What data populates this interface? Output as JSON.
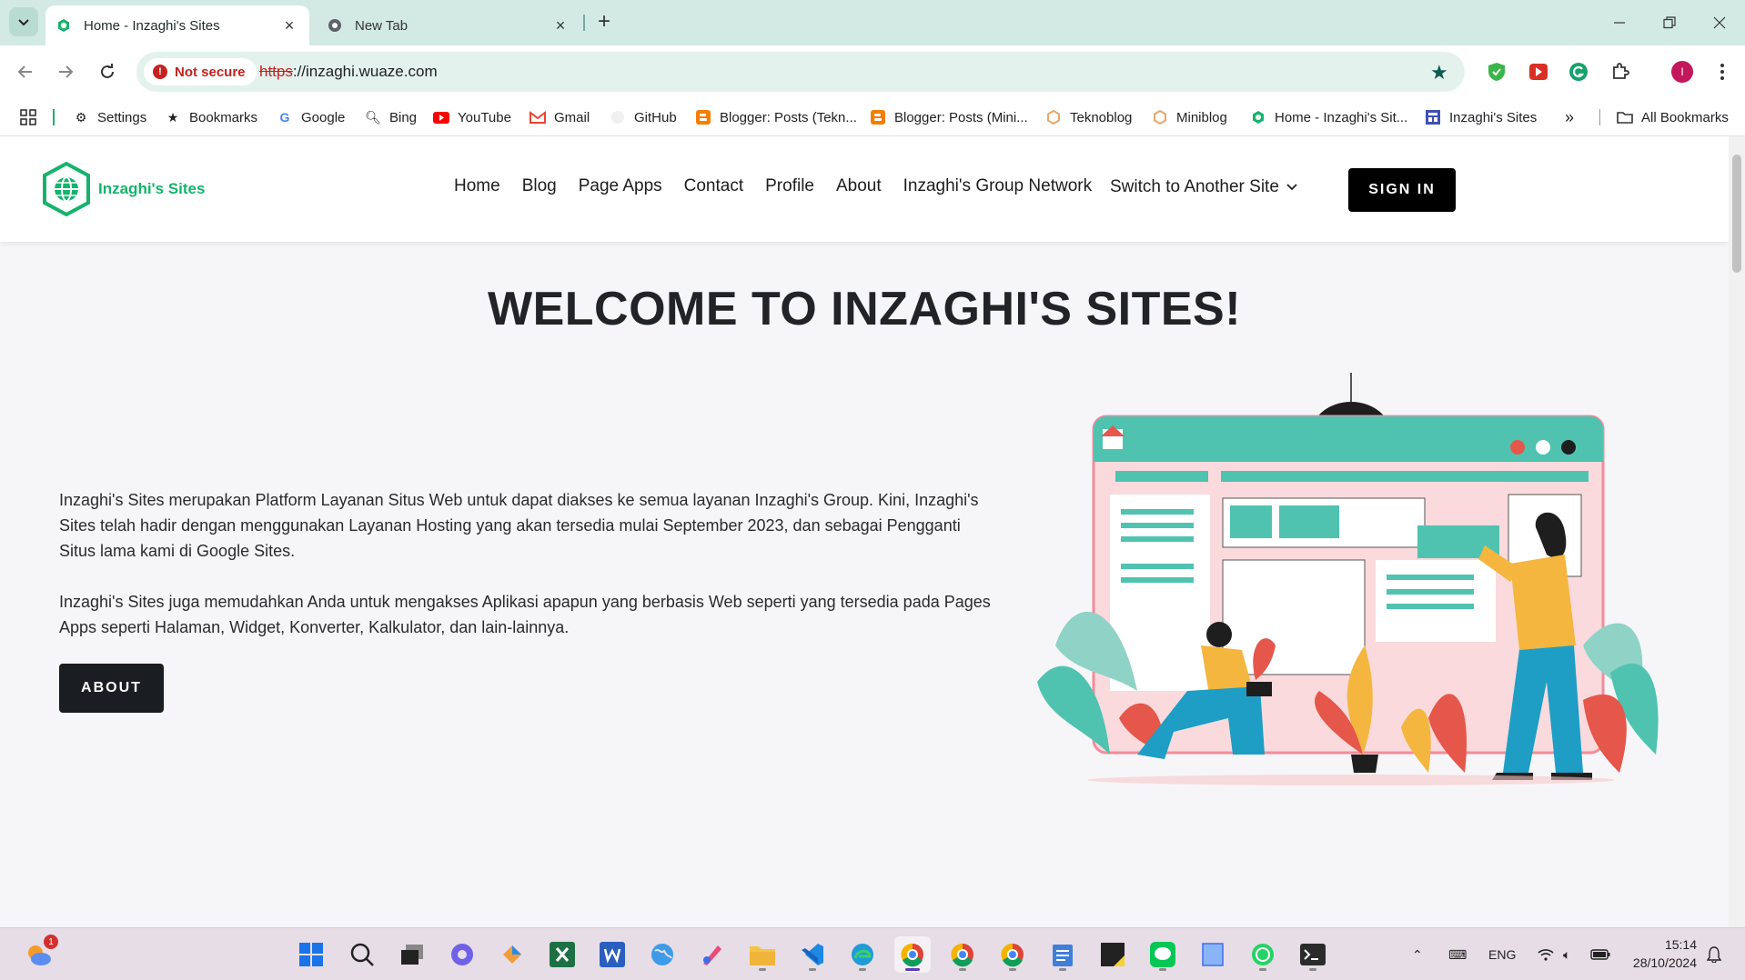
{
  "browser": {
    "tabs": [
      {
        "title": "Home - Inzaghi's Sites",
        "active": true
      },
      {
        "title": "New Tab",
        "active": false
      }
    ],
    "address": {
      "security_label": "Not secure",
      "scheme": "https",
      "rest": "://inzaghi.wuaze.com"
    },
    "bookmarks": [
      {
        "label": "Settings",
        "icon": "gear-icon"
      },
      {
        "label": "Bookmarks",
        "icon": "star-icon"
      },
      {
        "label": "Google",
        "icon": "google-icon"
      },
      {
        "label": "Bing",
        "icon": "search-icon"
      },
      {
        "label": "YouTube",
        "icon": "youtube-icon"
      },
      {
        "label": "Gmail",
        "icon": "gmail-icon"
      },
      {
        "label": "GitHub",
        "icon": "github-icon"
      },
      {
        "label": "Blogger: Posts (Tekn...",
        "icon": "blogger-icon"
      },
      {
        "label": "Blogger: Posts (Mini...",
        "icon": "blogger-icon"
      },
      {
        "label": "Teknoblog",
        "icon": "hexagon-icon"
      },
      {
        "label": "Miniblog",
        "icon": "hexagon-icon"
      },
      {
        "label": "Home - Inzaghi's Sit...",
        "icon": "site-icon"
      },
      {
        "label": "Inzaghi's Sites",
        "icon": "grid-site-icon"
      }
    ],
    "all_bookmarks": "All Bookmarks",
    "profile_initial": "I"
  },
  "site": {
    "logo_text": "Inzaghi's Sites",
    "nav": [
      "Home",
      "Blog",
      "Page Apps",
      "Contact",
      "Profile",
      "About",
      "Inzaghi's Group Network"
    ],
    "switch_label": "Switch to Another Site",
    "sign_in": "SIGN IN",
    "hero_title": "WELCOME TO INZAGHI'S SITES!",
    "paragraph_1": "Inzaghi's Sites merupakan Platform Layanan Situs Web untuk dapat diakses ke semua layanan Inzaghi's Group. Kini, Inzaghi's Sites telah hadir dengan menggunakan Layanan Hosting yang akan tersedia mulai September 2023, dan sebagai Pengganti Situs lama kami di Google Sites.",
    "paragraph_2": "Inzaghi's Sites juga memudahkan Anda untuk mengakses Aplikasi apapun yang berbasis Web seperti yang tersedia pada Pages Apps seperti Halaman, Widget, Konverter, Kalkulator, dan lain-lainnya.",
    "about_button": "ABOUT"
  },
  "taskbar": {
    "weather_badge": "1",
    "language": "ENG",
    "time": "15:14",
    "date": "28/10/2024"
  },
  "colors": {
    "brand_green": "#15b36b",
    "tab_strip": "#d3eae4",
    "security_red": "#c5221f"
  }
}
